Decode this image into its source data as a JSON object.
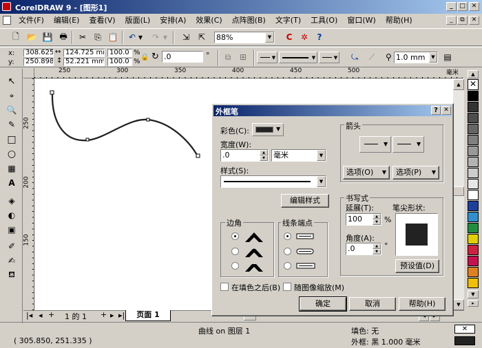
{
  "window": {
    "title": "CorelDRAW 9 - [图形1]"
  },
  "menu": [
    {
      "label": "文件(F)"
    },
    {
      "label": "编辑(E)"
    },
    {
      "label": "查看(V)"
    },
    {
      "label": "版面(L)"
    },
    {
      "label": "安排(A)"
    },
    {
      "label": "效果(C)"
    },
    {
      "label": "点阵图(B)"
    },
    {
      "label": "文字(T)"
    },
    {
      "label": "工具(O)"
    },
    {
      "label": "窗口(W)"
    },
    {
      "label": "帮助(H)"
    }
  ],
  "toolbar": {
    "zoom": "88%"
  },
  "propbar": {
    "x_label": "x:",
    "y_label": "y:",
    "x_val": "308.625",
    "y_val": "250.898",
    "w_val": "124.725 mm",
    "h_val": "52.221 mm",
    "sx": "100.0",
    "sy": "100.0",
    "pct": "%",
    "angle": ".0",
    "deg": "°",
    "outline_width": "1.0 mm"
  },
  "ruler": {
    "top_ticks": [
      "250",
      "300",
      "350",
      "400",
      "450",
      "500"
    ],
    "unit": "毫米",
    "left_ticks": [
      "250",
      "200",
      "150"
    ]
  },
  "page_nav": {
    "page_count": "1 的 1",
    "tab_label": "页面 1"
  },
  "dialog": {
    "title": "外框笔",
    "color_label": "彩色(C):",
    "width_label": "宽度(W):",
    "width_value": ".0",
    "unit_value": "毫米",
    "style_label": "样式(S):",
    "edit_style": "编辑样式",
    "arrows_label": "箭头",
    "options_left": "选项(O)",
    "options_right": "选项(P)",
    "calligraphy_label": "书写式",
    "stretch_label": "延展(T):",
    "stretch_value": "100",
    "stretch_unit": "%",
    "angle_label": "角度(A):",
    "angle_value": ".0",
    "angle_unit": "°",
    "nib_label": "笔尖形状:",
    "default_btn": "预设值(D)",
    "corners_label": "边角",
    "linecaps_label": "线条端点",
    "behind_fill": "在填色之后(B)",
    "scale_with_image": "随图像缩放(M)",
    "ok": "确定",
    "cancel": "取消",
    "help": "帮助(H)"
  },
  "status": {
    "object_info": "曲线 on 图层 1",
    "fill_label": "填色: 无",
    "outline_label": "外框: 黑  1.000 毫米",
    "coords": "( 305.850, 251.335 )"
  },
  "colors": {
    "title_start": "#0a246a",
    "title_end": "#a6caf0"
  }
}
